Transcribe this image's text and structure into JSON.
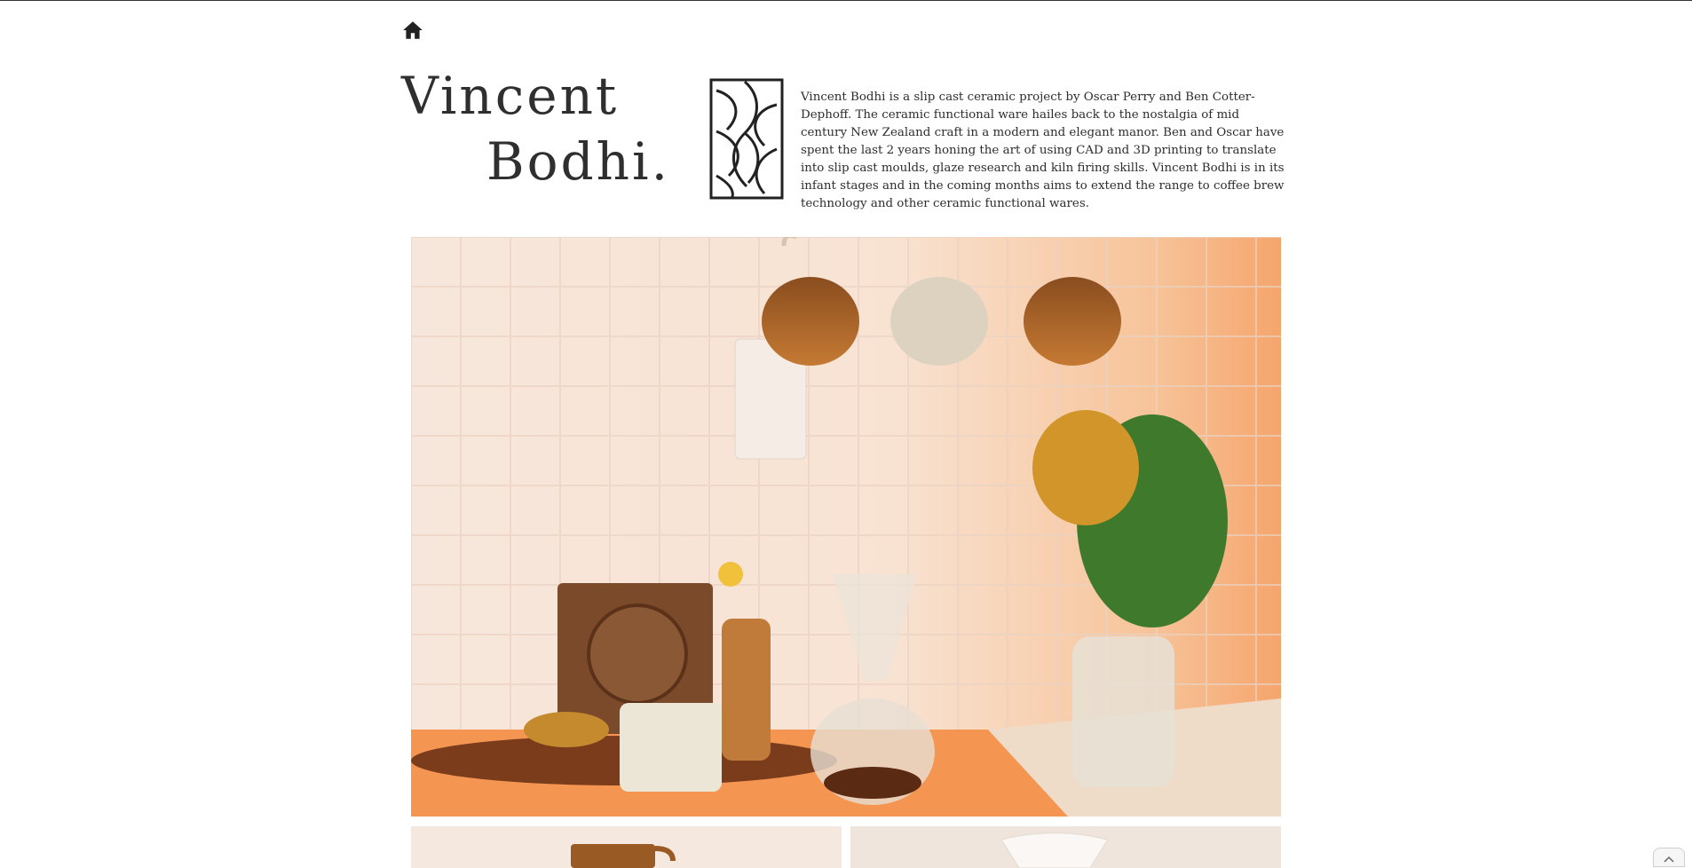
{
  "nav": {
    "home_icon": "home-icon"
  },
  "hero_title": {
    "line1": "Vincent",
    "line2": "Bodhi."
  },
  "logo": {
    "icon": "leaf-pattern-logo"
  },
  "description": "Vincent Bodhi is a slip cast ceramic project by Oscar Perry and Ben Cotter-Dephoff. The ceramic functional ware hailes back to the nostalgia of mid century New Zealand craft in a modern and elegant manor. Ben and Oscar have spent the last 2 years honing  the art of using CAD and 3D printing to translate into slip cast moulds, glaze research and kiln firing skills. Vincent Bodhi is in its infant stages and in the coming months aims to extend the range to coffee brew technology and other ceramic functional wares.",
  "scroll_top": {
    "icon": "chevron-up-icon"
  },
  "colors": {
    "accent_orange": "#f59a5c",
    "text": "#2b2b2b"
  }
}
